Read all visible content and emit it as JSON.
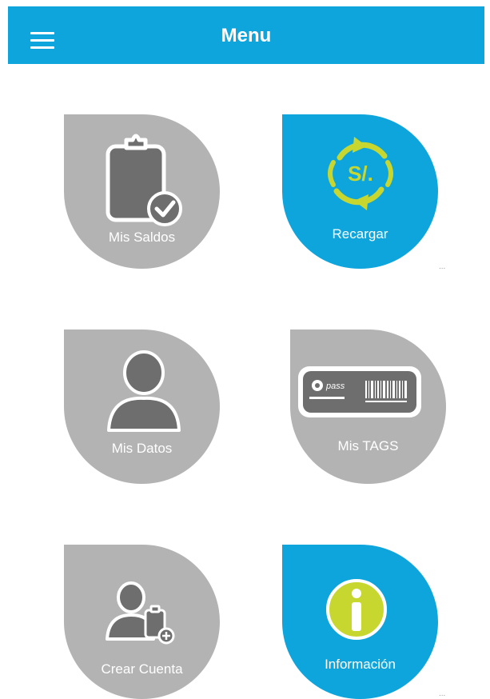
{
  "header": {
    "title": "Menu",
    "background": "#0ea5dc",
    "menu_icon": "hamburger-icon"
  },
  "tiles": [
    {
      "label": "Mis Saldos",
      "icon": "clipboard-check-icon",
      "color": "#b3b3b3"
    },
    {
      "label": "Recargar",
      "icon": "soles-refresh-icon",
      "color": "#0ea5dc"
    },
    {
      "label": "Mis Datos",
      "icon": "user-icon",
      "color": "#b3b3b3"
    },
    {
      "label": "Mis TAGS",
      "icon": "tag-card-icon",
      "color": "#b3b3b3",
      "card_brand": "pass"
    },
    {
      "label": "Crear Cuenta",
      "icon": "add-account-icon",
      "color": "#b3b3b3"
    },
    {
      "label": "Información",
      "icon": "info-icon",
      "color": "#0ea5dc"
    }
  ],
  "overflow_marks": [
    "...",
    "..."
  ]
}
